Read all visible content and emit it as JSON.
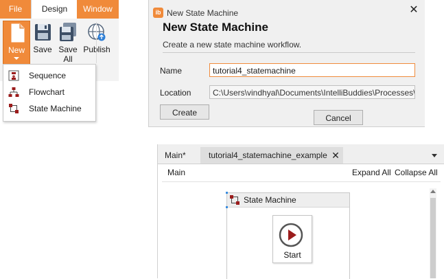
{
  "ribbon": {
    "tabs": [
      "File",
      "Design",
      "Window"
    ],
    "buttons": {
      "new": "New",
      "save": "Save",
      "save_all_line1": "Save",
      "save_all_line2": "All",
      "publish": "Publish"
    }
  },
  "new_menu": {
    "items": [
      {
        "label": "Sequence",
        "icon": "sequence-icon"
      },
      {
        "label": "Flowchart",
        "icon": "flowchart-icon"
      },
      {
        "label": "State Machine",
        "icon": "state-machine-icon"
      }
    ]
  },
  "dialog": {
    "logo": "ib",
    "window_title": "New State Machine",
    "heading": "New State Machine",
    "subtitle": "Create a new state machine workflow.",
    "name_label": "Name",
    "name_value": "tutorial4_statemachine",
    "location_label": "Location",
    "location_value": "C:\\Users\\vindhyal\\Documents\\IntelliBuddies\\Processes\\tut",
    "create_label": "Create",
    "cancel_label": "Cancel"
  },
  "designer": {
    "tabs": [
      {
        "label": "Main*"
      },
      {
        "label": "tutorial4_statemachine_example"
      }
    ],
    "breadcrumb": "Main",
    "expand_all": "Expand All",
    "collapse_all": "Collapse All",
    "activity_title": "State Machine",
    "start_label": "Start"
  },
  "colors": {
    "accent": "#f08a3a",
    "start_circle": "#555555",
    "start_triangle": "#9b1c1c",
    "selection": "#3b8ee0"
  }
}
